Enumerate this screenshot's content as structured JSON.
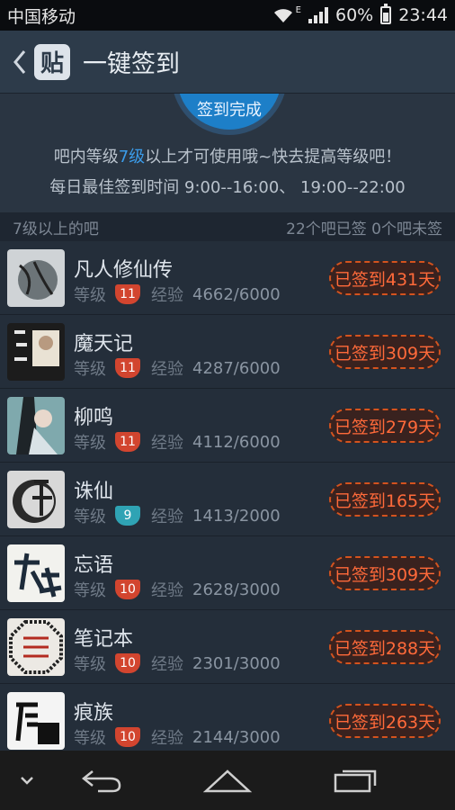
{
  "status_bar": {
    "carrier": "中国移动",
    "network": "E",
    "battery": "60%",
    "time": "23:44",
    "battery_level": 0.6
  },
  "header": {
    "logo_char": "贴",
    "title": "一键签到"
  },
  "banner": {
    "circle_text": "签到完成",
    "hint_prefix": "吧内等级",
    "hint_level": "7级",
    "hint_suffix": "以上才可使用哦~快去提高等级吧！",
    "best_time": "每日最佳签到时间  9:00--16:00、 19:00--22:00"
  },
  "section": {
    "left": "7级以上的吧",
    "right": "22个吧已签  0个吧未签"
  },
  "labels": {
    "level": "等级",
    "exp": "经验"
  },
  "colors": {
    "accent": "#3b9be8",
    "badge_red": "#d2452f",
    "badge_teal": "#2fa3b4",
    "signed": "#ff6a3a"
  },
  "forums": [
    {
      "name": "凡人修仙传",
      "level": "11",
      "exp": "4662/6000",
      "signed": "已签到431天",
      "badge": "red"
    },
    {
      "name": "魔天记",
      "level": "11",
      "exp": "4287/6000",
      "signed": "已签到309天",
      "badge": "red"
    },
    {
      "name": "柳鸣",
      "level": "11",
      "exp": "4112/6000",
      "signed": "已签到279天",
      "badge": "red"
    },
    {
      "name": "诛仙",
      "level": "9",
      "exp": "1413/2000",
      "signed": "已签到165天",
      "badge": "teal"
    },
    {
      "name": "忘语",
      "level": "10",
      "exp": "2628/3000",
      "signed": "已签到309天",
      "badge": "red"
    },
    {
      "name": "笔记本",
      "level": "10",
      "exp": "2301/3000",
      "signed": "已签到288天",
      "badge": "red"
    },
    {
      "name": "痕族",
      "level": "10",
      "exp": "2144/3000",
      "signed": "已签到263天",
      "badge": "red"
    }
  ]
}
